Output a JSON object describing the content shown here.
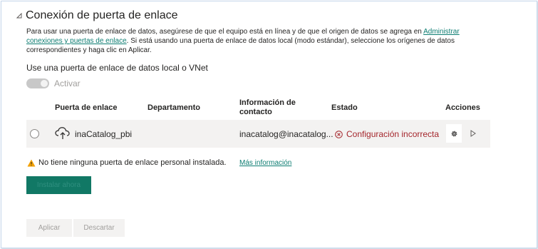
{
  "section": {
    "title": "Conexión de puerta de enlace",
    "description_part1": "Para usar una puerta de enlace de datos, asegúrese de que el equipo está en línea y de que el origen de datos se agrega en ",
    "description_link": "Administrar conexiones y puertas de enlace",
    "description_part2": ". Si está usando una puerta de enlace de datos local (modo estándar), seleccione los orígenes de datos correspondientes y haga clic en Aplicar."
  },
  "local_gateway": {
    "label": "Use una puerta de enlace de datos local o VNet",
    "toggle_label": "Activar",
    "toggle_on": true
  },
  "table": {
    "headers": {
      "gateway": "Puerta de enlace",
      "department": "Departamento",
      "contact_line1": "Información de",
      "contact_line2": "contacto",
      "status": "Estado",
      "actions": "Acciones"
    },
    "rows": [
      {
        "gateway": "inaCatalog_pbi",
        "department": "",
        "contact": "inacatalog@inacatalog...",
        "status": "Configuración incorrecta"
      }
    ]
  },
  "personal_gateway": {
    "warning": "No tiene ninguna puerta de enlace personal instalada.",
    "more_info": "Más información",
    "install_label": "Instalar ahora"
  },
  "footer": {
    "apply_label": "Aplicar",
    "discard_label": "Descartar"
  },
  "colors": {
    "accent": "#117865",
    "link": "#0d7d72",
    "error": "#a4262c",
    "warning": "#f2a000"
  }
}
